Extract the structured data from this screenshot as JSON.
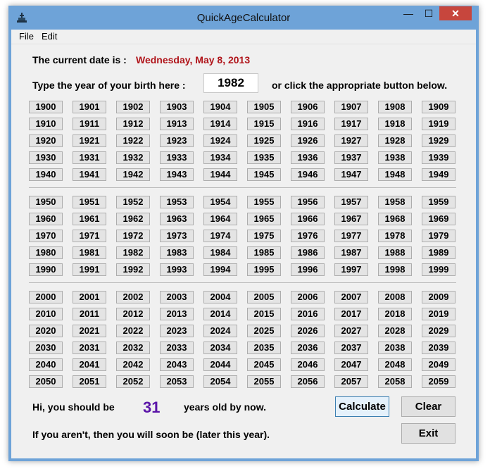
{
  "window": {
    "title": "QuickAgeCalculator",
    "controls": {
      "minimize": "—",
      "maximize": "☐",
      "close": "✕"
    }
  },
  "menu": {
    "items": [
      "File",
      "Edit"
    ]
  },
  "date_row": {
    "label": "The current date is :",
    "value": "Wednesday, May 8, 2013"
  },
  "birth_row": {
    "label": "Type the year of your birth here :",
    "input_value": "1982",
    "hint": "or click the appropriate button below."
  },
  "year_groups": [
    {
      "rows": [
        [
          "1900",
          "1901",
          "1902",
          "1903",
          "1904",
          "1905",
          "1906",
          "1907",
          "1908",
          "1909"
        ],
        [
          "1910",
          "1911",
          "1912",
          "1913",
          "1914",
          "1915",
          "1916",
          "1917",
          "1918",
          "1919"
        ],
        [
          "1920",
          "1921",
          "1922",
          "1923",
          "1924",
          "1925",
          "1926",
          "1927",
          "1928",
          "1929"
        ],
        [
          "1930",
          "1931",
          "1932",
          "1933",
          "1934",
          "1935",
          "1936",
          "1937",
          "1938",
          "1939"
        ],
        [
          "1940",
          "1941",
          "1942",
          "1943",
          "1944",
          "1945",
          "1946",
          "1947",
          "1948",
          "1949"
        ]
      ]
    },
    {
      "rows": [
        [
          "1950",
          "1951",
          "1952",
          "1953",
          "1954",
          "1955",
          "1956",
          "1957",
          "1958",
          "1959"
        ],
        [
          "1960",
          "1961",
          "1962",
          "1963",
          "1964",
          "1965",
          "1966",
          "1967",
          "1968",
          "1969"
        ],
        [
          "1970",
          "1971",
          "1972",
          "1973",
          "1974",
          "1975",
          "1976",
          "1977",
          "1978",
          "1979"
        ],
        [
          "1980",
          "1981",
          "1982",
          "1983",
          "1984",
          "1985",
          "1986",
          "1987",
          "1988",
          "1989"
        ],
        [
          "1990",
          "1991",
          "1992",
          "1993",
          "1994",
          "1995",
          "1996",
          "1997",
          "1998",
          "1999"
        ]
      ]
    },
    {
      "rows": [
        [
          "2000",
          "2001",
          "2002",
          "2003",
          "2004",
          "2005",
          "2006",
          "2007",
          "2008",
          "2009"
        ],
        [
          "2010",
          "2011",
          "2012",
          "2013",
          "2014",
          "2015",
          "2016",
          "2017",
          "2018",
          "2019"
        ],
        [
          "2020",
          "2021",
          "2022",
          "2023",
          "2024",
          "2025",
          "2026",
          "2027",
          "2028",
          "2029"
        ],
        [
          "2030",
          "2031",
          "2032",
          "2033",
          "2034",
          "2035",
          "2036",
          "2037",
          "2038",
          "2039"
        ],
        [
          "2040",
          "2041",
          "2042",
          "2043",
          "2044",
          "2045",
          "2046",
          "2047",
          "2048",
          "2049"
        ],
        [
          "2050",
          "2051",
          "2052",
          "2053",
          "2054",
          "2055",
          "2056",
          "2057",
          "2058",
          "2059"
        ]
      ]
    }
  ],
  "result": {
    "prefix": "Hi, you should be",
    "age": "31",
    "suffix": "years old by now.",
    "note": "If you aren't, then you will soon be (later this year)."
  },
  "buttons": {
    "calculate": "Calculate",
    "clear": "Clear",
    "exit": "Exit"
  },
  "colors": {
    "title_bar": "#6ea3d8",
    "client_bg": "#f0f0f0",
    "date_text": "#b0141a",
    "age_text": "#5a14a8",
    "close_button": "#c7463d"
  }
}
